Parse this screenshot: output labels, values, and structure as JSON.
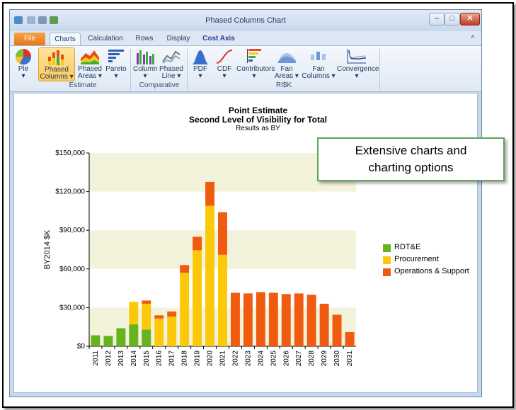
{
  "window": {
    "title": "Phased Columns Chart"
  },
  "tabs": [
    {
      "label": "File"
    },
    {
      "label": "Charts"
    },
    {
      "label": "Calculation"
    },
    {
      "label": "Rows"
    },
    {
      "label": "Display"
    },
    {
      "label": "Cost Axis"
    }
  ],
  "window_controls": {
    "minimize": "–",
    "maximize": "□",
    "close": "✕",
    "collapse_ribbon": "^"
  },
  "ribbon": {
    "buttons": [
      {
        "label": "Pie",
        "label2": "▾",
        "icon": "pie-chart-icon"
      },
      {
        "label": "Phased",
        "label2": "Columns ▾",
        "icon": "phased-columns-icon"
      },
      {
        "label": "Phased",
        "label2": "Areas ▾",
        "icon": "phased-areas-icon"
      },
      {
        "label": "Pareto",
        "label2": "▾",
        "icon": "pareto-icon"
      },
      {
        "label": "Column",
        "label2": "▾",
        "icon": "column-chart-icon"
      },
      {
        "label": "Phased",
        "label2": "Line ▾",
        "icon": "phased-line-icon"
      },
      {
        "label": "PDF",
        "label2": "▾",
        "icon": "pdf-curve-icon"
      },
      {
        "label": "CDF",
        "label2": "▾",
        "icon": "cdf-curve-icon"
      },
      {
        "label": "Contributors",
        "label2": "▾",
        "icon": "contributors-icon"
      },
      {
        "label": "Fan",
        "label2": "Areas ▾",
        "icon": "fan-areas-icon"
      },
      {
        "label": "Fan",
        "label2": "Columns ▾",
        "icon": "fan-columns-icon"
      },
      {
        "label": "Convergence",
        "label2": "▾",
        "icon": "convergence-icon"
      }
    ],
    "groups": [
      {
        "label": "Estimate"
      },
      {
        "label": "Comparative"
      },
      {
        "label": "RI$K"
      }
    ]
  },
  "callout": {
    "text": "Extensive charts and charting options"
  },
  "chart_data": {
    "type": "bar",
    "stacked": true,
    "title": "Point Estimate",
    "subtitle": "Second Level of Visibility for Total",
    "note": "Results as BY",
    "ylabel": "BY2014 $K",
    "xlabel": "",
    "ylim": [
      0,
      150000
    ],
    "yticks": [
      "$0",
      "$30,000",
      "$60,000",
      "$90,000",
      "$120,000",
      "$150,000"
    ],
    "ytick_values": [
      0,
      30000,
      60000,
      90000,
      120000,
      150000
    ],
    "categories": [
      "2011",
      "2012",
      "2013",
      "2014",
      "2015",
      "2016",
      "2017",
      "2018",
      "2019",
      "2020",
      "2021",
      "2022",
      "2023",
      "2024",
      "2025",
      "2026",
      "2027",
      "2028",
      "2029",
      "2030",
      "2031"
    ],
    "series": [
      {
        "name": "RDT&E",
        "color": "#66b21f",
        "values": [
          8500,
          8000,
          14000,
          17000,
          13000,
          0,
          0,
          0,
          0,
          0,
          0,
          0,
          0,
          0,
          0,
          0,
          0,
          0,
          0,
          0,
          0
        ]
      },
      {
        "name": "Procurement",
        "color": "#fcc80a",
        "values": [
          0,
          0,
          0,
          17500,
          20000,
          21500,
          23000,
          57000,
          74500,
          109000,
          71000,
          0,
          0,
          0,
          0,
          0,
          0,
          0,
          0,
          0,
          0
        ]
      },
      {
        "name": "Operations & Support",
        "color": "#f05b10",
        "values": [
          0,
          0,
          0,
          0,
          2500,
          2500,
          4000,
          6000,
          10500,
          18500,
          33000,
          41500,
          41000,
          42000,
          41500,
          40500,
          41000,
          40000,
          33000,
          24500,
          11000
        ]
      }
    ],
    "legend_position": "right",
    "grid": true
  }
}
